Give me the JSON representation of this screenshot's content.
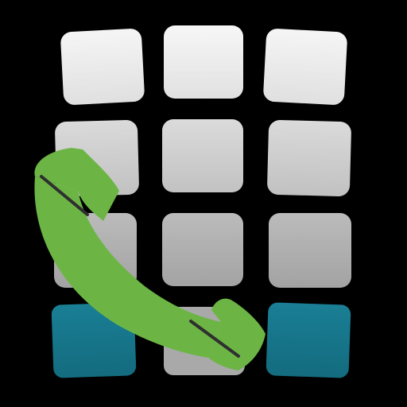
{
  "icon": {
    "icon_name": "phone-dialer-app-icon",
    "keypad_icon": "keypad-grid-icon",
    "handset_icon": "phone-handset-icon"
  },
  "colors": {
    "background": "#000000",
    "key_top": "#f7f7f7",
    "key_upper_mid": "#c8c8c8",
    "key_lower_mid": "#a3a3a3",
    "key_bottom": "#16758a",
    "handset": "#6cb545",
    "handset_seam": "#2f2f2f"
  }
}
